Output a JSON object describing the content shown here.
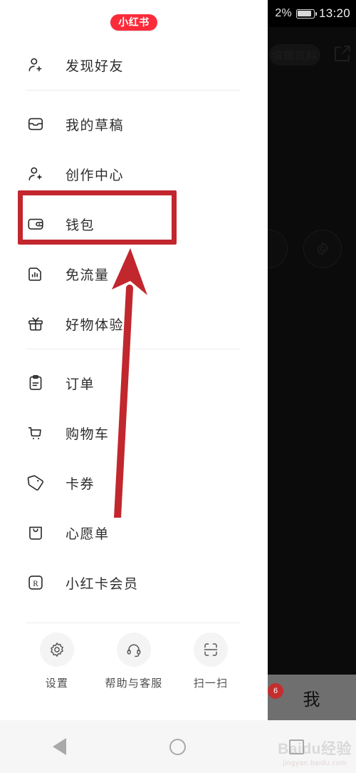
{
  "status_bar": {
    "battery_percent": "2%",
    "time": "13:20"
  },
  "drawer": {
    "brand_logo_text": "小红书",
    "groups": [
      {
        "items": [
          {
            "icon": "person-add-icon",
            "label": "发现好友"
          }
        ]
      },
      {
        "items": [
          {
            "icon": "drafts-tray-icon",
            "label": "我的草稿"
          },
          {
            "icon": "person-star-icon",
            "label": "创作中心",
            "highlighted": true
          },
          {
            "icon": "wallet-icon",
            "label": "钱包"
          },
          {
            "icon": "sim-data-icon",
            "label": "免流量"
          },
          {
            "icon": "gift-icon",
            "label": "好物体验"
          }
        ]
      },
      {
        "items": [
          {
            "icon": "clipboard-icon",
            "label": "订单"
          },
          {
            "icon": "shopping-cart-icon",
            "label": "购物车"
          },
          {
            "icon": "coupon-tag-icon",
            "label": "卡券"
          },
          {
            "icon": "wishlist-bag-icon",
            "label": "心愿单"
          },
          {
            "icon": "r-badge-icon",
            "label": "小红卡会员"
          }
        ]
      }
    ],
    "quick_actions": [
      {
        "icon": "gear-icon",
        "label": "设置"
      },
      {
        "icon": "headset-icon",
        "label": "帮助与客服"
      },
      {
        "icon": "scan-icon",
        "label": "扫一扫"
      }
    ]
  },
  "background_app": {
    "ghost_pill_label": "编辑资料",
    "bottom_tab_label": "我",
    "bottom_tab_badge": "6"
  },
  "annotations": {
    "highlight_color": "#c1272d",
    "box_target": "创作中心",
    "arrow_points_to": "创作中心"
  },
  "navigation_bar": {
    "back_label": "back",
    "home_label": "home",
    "recents_label": "recents"
  },
  "watermark": {
    "main": "Baidu经验",
    "sub": "jingyan.baidu.com"
  }
}
